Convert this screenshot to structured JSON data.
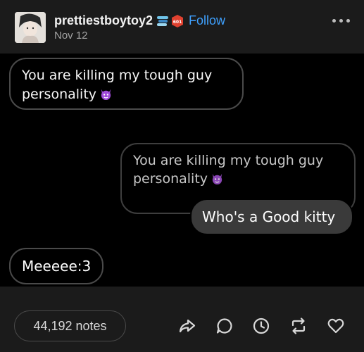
{
  "post": {
    "username": "prettiestboytoy2",
    "date": "Nov 12",
    "follow_label": "Follow"
  },
  "chat": {
    "message_1": "You are killing my tough guy personality",
    "message_2": "You are killing my tough guy personality",
    "message_3": "Who's a Good kitty",
    "message_4": "Meeeee:3"
  },
  "footer": {
    "notes_label": "44,192 notes"
  },
  "colors": {
    "follow": "#3fa1ff",
    "background": "#1b1b1b",
    "bubble_fill": "#3a3a3a",
    "devil_emoji": "#a04ad8"
  },
  "icons": [
    "more-icon",
    "share-icon",
    "reply-icon",
    "history-icon",
    "reblog-icon",
    "like-icon"
  ]
}
